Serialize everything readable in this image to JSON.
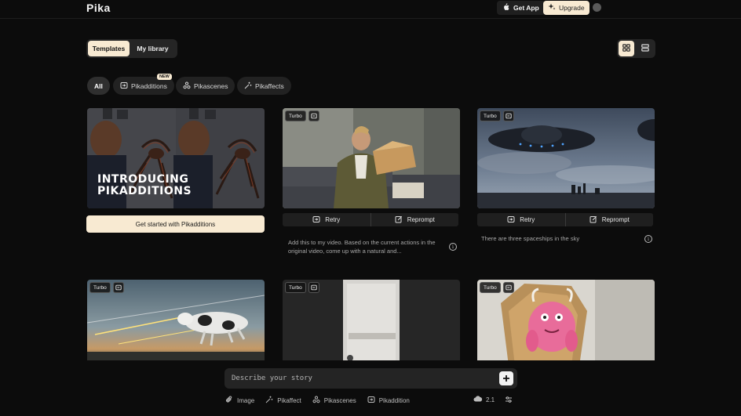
{
  "header": {
    "logo": "Pika",
    "get_app": "Get App",
    "upgrade": "Upgrade"
  },
  "tabs": [
    {
      "label": "Templates",
      "active": true
    },
    {
      "label": "My library",
      "active": false
    }
  ],
  "filters": [
    {
      "label": "All",
      "active": true,
      "icon": "none"
    },
    {
      "label": "Pikadditions",
      "icon": "pikadditions-icon",
      "badge": "NEW"
    },
    {
      "label": "Pikascenes",
      "icon": "pikascenes-icon"
    },
    {
      "label": "Pikaffects",
      "icon": "pikaffects-icon"
    }
  ],
  "feature_card": {
    "headline_line1": "INTRODUCING",
    "headline_line2": "PIKADDITIONS",
    "cta": "Get started with Pikadditions"
  },
  "cards": [
    {
      "badge": "Turbo",
      "retry": "Retry",
      "reprompt": "Reprompt",
      "description": "Add this to my video. Based on the current actions in the original video, come up with a natural and..."
    },
    {
      "badge": "Turbo",
      "retry": "Retry",
      "reprompt": "Reprompt",
      "description": "There are three spaceships in the sky"
    },
    {
      "badge": "Turbo"
    },
    {
      "badge": "Turbo"
    },
    {
      "badge": "Turbo"
    }
  ],
  "prompt": {
    "placeholder": "Describe your story",
    "tools": [
      "Image",
      "Pikaffect",
      "Pikascenes",
      "Pikaddition"
    ],
    "model_version": "2.1"
  },
  "colors": {
    "background": "#0c0c0c",
    "accent": "#f8ead2",
    "surface": "#242424"
  }
}
